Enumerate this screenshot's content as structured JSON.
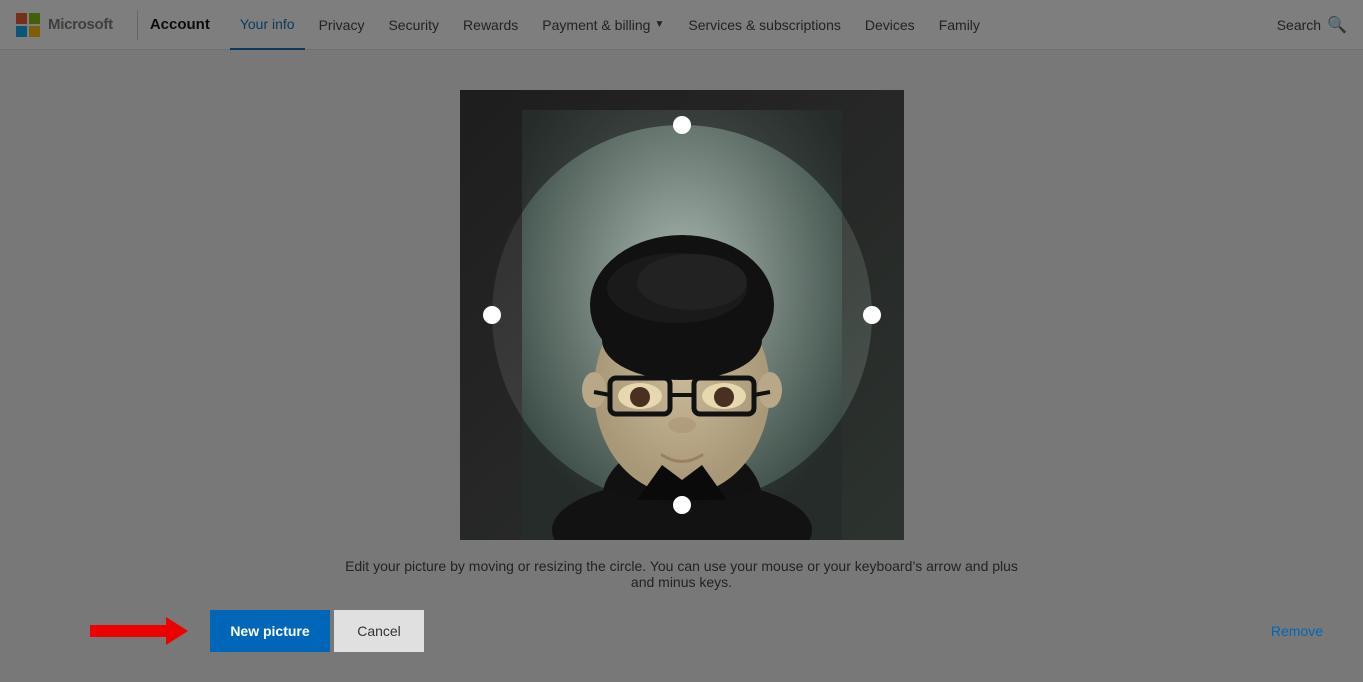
{
  "header": {
    "logo_text": "Microsoft",
    "account_label": "Account",
    "nav_items": [
      {
        "id": "your-info",
        "label": "Your info",
        "active": true,
        "has_arrow": false
      },
      {
        "id": "privacy",
        "label": "Privacy",
        "active": false,
        "has_arrow": false
      },
      {
        "id": "security",
        "label": "Security",
        "active": false,
        "has_arrow": false
      },
      {
        "id": "rewards",
        "label": "Rewards",
        "active": false,
        "has_arrow": false
      },
      {
        "id": "payment-billing",
        "label": "Payment & billing",
        "active": false,
        "has_arrow": true
      },
      {
        "id": "services-subscriptions",
        "label": "Services & subscriptions",
        "active": false,
        "has_arrow": false
      },
      {
        "id": "devices",
        "label": "Devices",
        "active": false,
        "has_arrow": false
      },
      {
        "id": "family",
        "label": "Family",
        "active": false,
        "has_arrow": false
      }
    ],
    "search_label": "Search"
  },
  "main": {
    "instruction_text": "Edit your picture by moving or resizing the circle. You can use your mouse or your keyboard’s arrow and plus and minus keys.",
    "new_picture_label": "New picture",
    "cancel_label": "Cancel",
    "remove_label": "Remove"
  }
}
